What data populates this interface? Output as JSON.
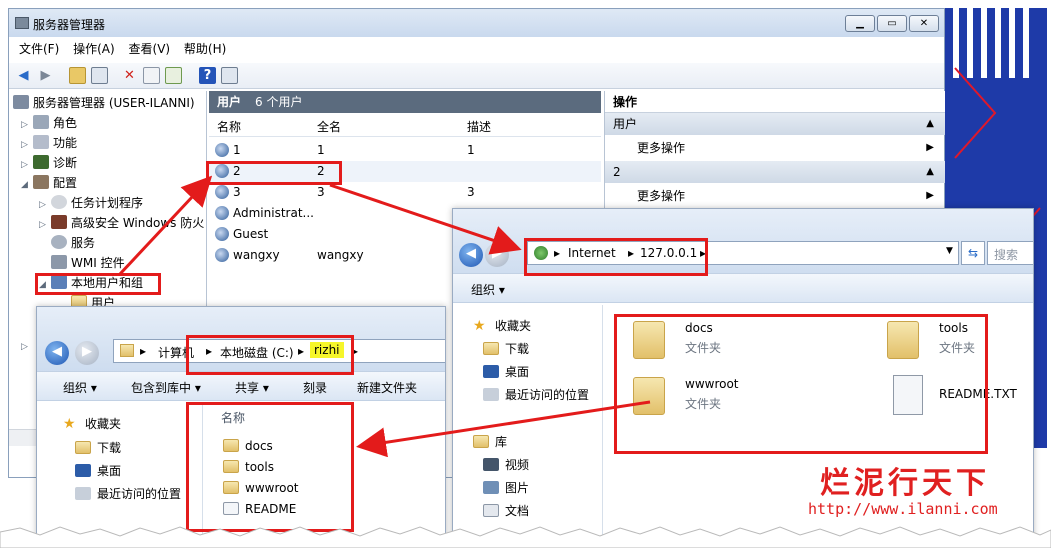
{
  "server_manager": {
    "title": "服务器管理器",
    "controls": [
      "▁",
      "▭",
      "✕"
    ],
    "menu": [
      "文件(F)",
      "操作(A)",
      "查看(V)",
      "帮助(H)"
    ],
    "tree": [
      {
        "label": "服务器管理器 (USER-ILANNI)",
        "icon": "server-icon"
      },
      {
        "label": "角色",
        "icon": "roles-icon"
      },
      {
        "label": "功能",
        "icon": "features-icon"
      },
      {
        "label": "诊断",
        "icon": "diagnostics-icon"
      },
      {
        "label": "配置",
        "icon": "configuration-icon"
      },
      {
        "label": "任务计划程序",
        "icon": "clock-icon"
      },
      {
        "label": "高级安全 Windows 防火",
        "icon": "firewall-icon"
      },
      {
        "label": "服务",
        "icon": "gear-icon"
      },
      {
        "label": "WMI 控件",
        "icon": "wmi-icon"
      },
      {
        "label": "本地用户和组",
        "icon": "users-group-icon"
      },
      {
        "label": "用户",
        "icon": "folder-icon"
      }
    ],
    "list": {
      "header": "用户",
      "count": "6 个用户",
      "columns": [
        "名称",
        "全名",
        "描述"
      ],
      "rows": [
        {
          "name": "1",
          "fullname": "1",
          "desc": "1"
        },
        {
          "name": "2",
          "fullname": "2",
          "desc": ""
        },
        {
          "name": "3",
          "fullname": "3",
          "desc": "3"
        },
        {
          "name": "Administrat...",
          "fullname": "",
          "desc": ""
        },
        {
          "name": "Guest",
          "fullname": "",
          "desc": ""
        },
        {
          "name": "wangxy",
          "fullname": "wangxy",
          "desc": ""
        }
      ]
    },
    "actions": {
      "title": "操作",
      "sections": [
        {
          "label": "用户",
          "item": "更多操作"
        },
        {
          "label": "2",
          "item": "更多操作"
        }
      ]
    }
  },
  "explorer_right": {
    "breadcrumb": [
      "Internet",
      "127.0.0.1"
    ],
    "search_placeholder": "搜索",
    "toolbar": [
      "组织 ▾"
    ],
    "nav": [
      "收藏夹",
      "下载",
      "桌面",
      "最近访问的位置",
      "库",
      "视频",
      "图片",
      "文档"
    ],
    "items": [
      {
        "name": "docs",
        "type": "文件夹"
      },
      {
        "name": "tools",
        "type": "文件夹"
      },
      {
        "name": "wwwroot",
        "type": "文件夹"
      },
      {
        "name": "README.TXT",
        "type": ""
      }
    ]
  },
  "explorer_left": {
    "breadcrumb": [
      "计算机",
      "本地磁盘 (C:)",
      "rizhi"
    ],
    "toolbar": [
      "组织 ▾",
      "包含到库中 ▾",
      "共享 ▾",
      "刻录",
      "新建文件夹"
    ],
    "nav": [
      "收藏夹",
      "下载",
      "桌面",
      "最近访问的位置"
    ],
    "column": "名称",
    "files": [
      "docs",
      "tools",
      "wwwroot",
      "README"
    ]
  },
  "watermark": {
    "text": "烂泥行天下",
    "url": "http://www.ilanni.com"
  },
  "colors": {
    "annotation": "#e31b1b",
    "highlight": "#f6f62a",
    "panel_header": "#5b6b7e"
  }
}
